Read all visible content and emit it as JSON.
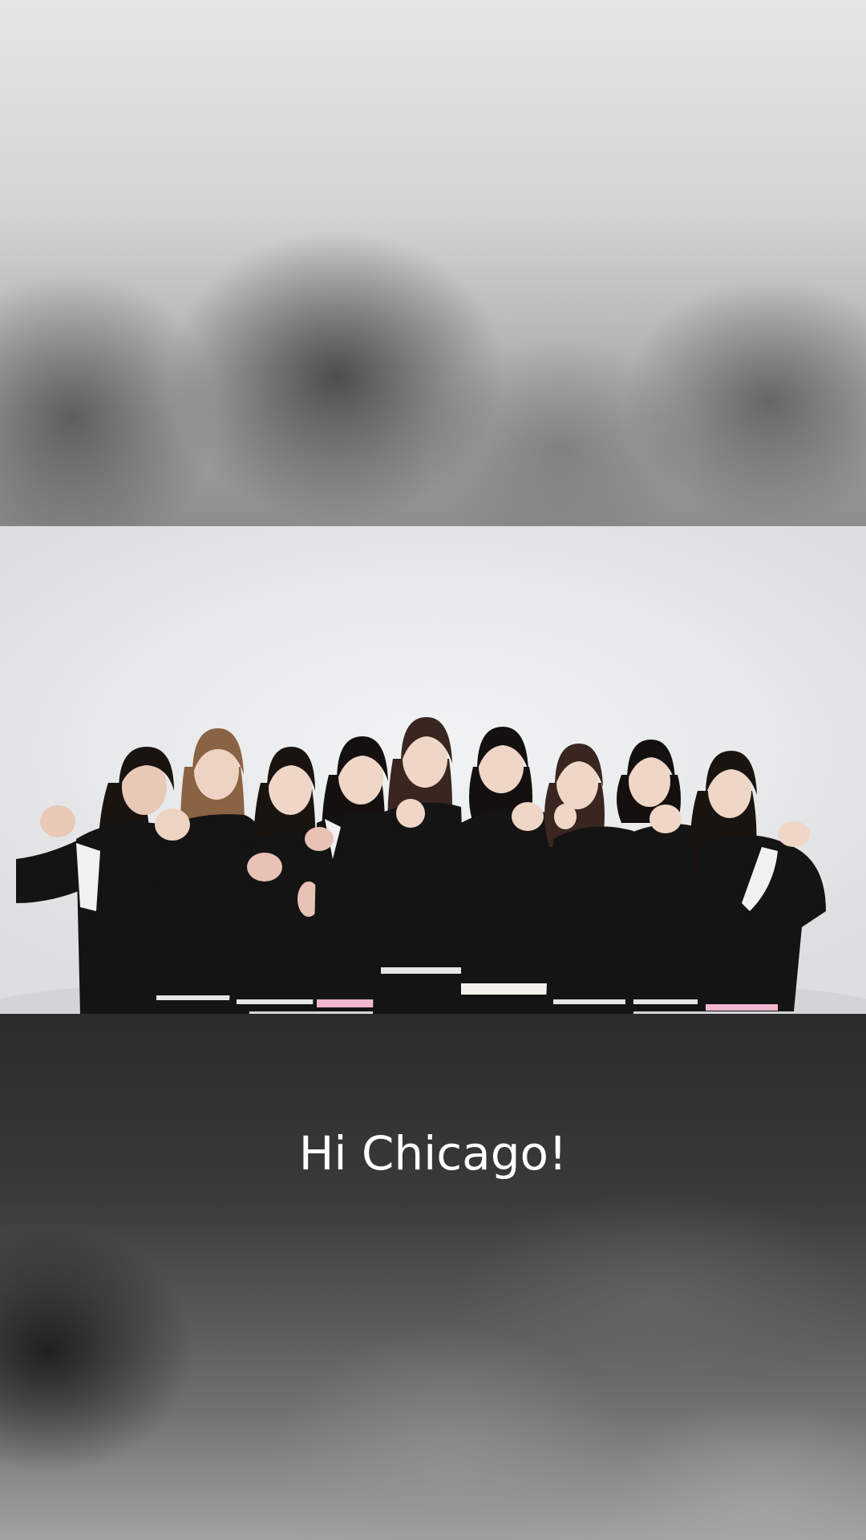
{
  "video": {
    "caption": "Hi Chicago!"
  },
  "colors": {
    "caption_text": "#ffffff",
    "jacket": "#141414",
    "backdrop": "#e6e8ea"
  }
}
